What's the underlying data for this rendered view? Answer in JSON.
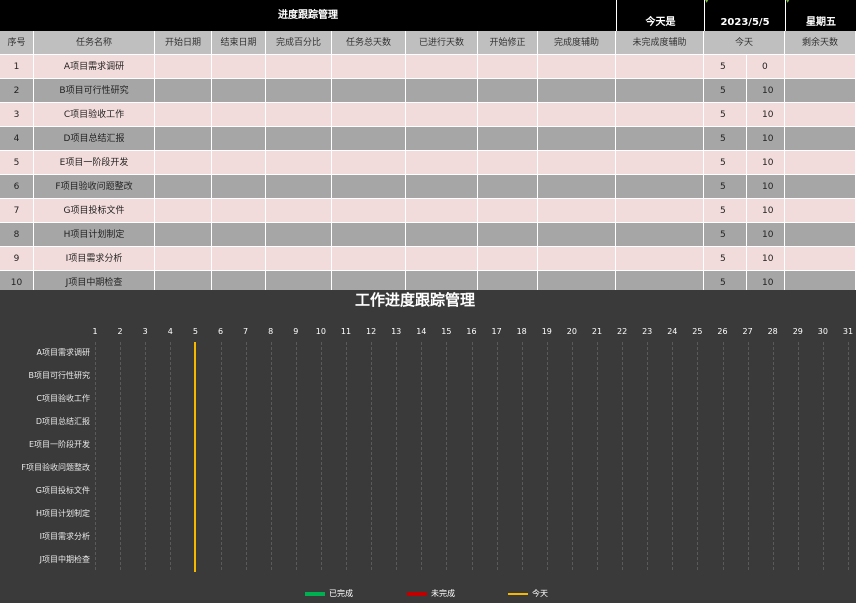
{
  "header": {
    "title": "进度跟踪管理",
    "today_label": "今天是",
    "date": "2023/5/5",
    "weekday": "星期五"
  },
  "table": {
    "columns": [
      "序号",
      "任务名称",
      "开始日期",
      "结束日期",
      "完成百分比",
      "任务总天数",
      "已进行天数",
      "开始修正",
      "完成度辅助",
      "未完成度辅助",
      "今天",
      "剩余天数"
    ],
    "rows": [
      {
        "no": "1",
        "task": "A项目需求调研",
        "today": "5",
        "remain": "0"
      },
      {
        "no": "2",
        "task": "B项目可行性研究",
        "today": "5",
        "remain": "10"
      },
      {
        "no": "3",
        "task": "C项目验收工作",
        "today": "5",
        "remain": "10"
      },
      {
        "no": "4",
        "task": "D项目总结汇报",
        "today": "5",
        "remain": "10"
      },
      {
        "no": "5",
        "task": "E项目一阶段开发",
        "today": "5",
        "remain": "10"
      },
      {
        "no": "6",
        "task": "F项目验收问题整改",
        "today": "5",
        "remain": "10"
      },
      {
        "no": "7",
        "task": "G项目投标文件",
        "today": "5",
        "remain": "10"
      },
      {
        "no": "8",
        "task": "H项目计划制定",
        "today": "5",
        "remain": "10"
      },
      {
        "no": "9",
        "task": "I项目需求分析",
        "today": "5",
        "remain": "10"
      },
      {
        "no": "10",
        "task": "J项目中期检查",
        "today": "5",
        "remain": "10"
      }
    ]
  },
  "chart_data": {
    "type": "bar",
    "title": "工作进度跟踪管理",
    "x": [
      "1",
      "2",
      "3",
      "4",
      "5",
      "6",
      "7",
      "8",
      "9",
      "10",
      "11",
      "12",
      "13",
      "14",
      "15",
      "16",
      "17",
      "18",
      "19",
      "20",
      "21",
      "22",
      "23",
      "24",
      "25",
      "26",
      "27",
      "28",
      "29",
      "30",
      "31"
    ],
    "categories": [
      "A项目需求调研",
      "B项目可行性研究",
      "C项目验收工作",
      "D项目总结汇报",
      "E项目一阶段开发",
      "F项目验收问题整改",
      "G项目投标文件",
      "H项目计划制定",
      "I项目需求分析",
      "J项目中期检查"
    ],
    "series": [
      {
        "name": "已完成",
        "color": "#00b050",
        "values": [
          0,
          0,
          0,
          0,
          0,
          0,
          0,
          0,
          0,
          0
        ]
      },
      {
        "name": "未完成",
        "color": "#c00000",
        "values": [
          0,
          0,
          0,
          0,
          0,
          0,
          0,
          0,
          0,
          0
        ]
      }
    ],
    "today": 5,
    "today_name": "今天",
    "today_color": "#f5b800",
    "xlim": [
      1,
      31
    ],
    "legend": "bottom"
  }
}
